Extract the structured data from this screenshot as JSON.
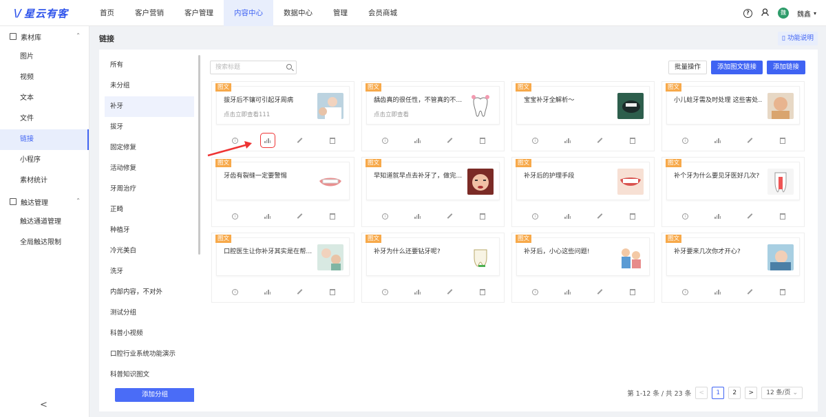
{
  "app": {
    "logo_mark": "\\/",
    "logo_text": "星云有客"
  },
  "nav": [
    {
      "label": "首页"
    },
    {
      "label": "客户营销"
    },
    {
      "label": "客户管理"
    },
    {
      "label": "内容中心",
      "active": true
    },
    {
      "label": "数据中心"
    },
    {
      "label": "管理"
    },
    {
      "label": "会员商城"
    }
  ],
  "user": {
    "avatar_text": "魏",
    "name": "魏鑫"
  },
  "sidebar": {
    "groups": [
      {
        "label": "素材库",
        "items": [
          "图片",
          "视频",
          "文本",
          "文件",
          "链接",
          "小程序",
          "素材统计"
        ]
      },
      {
        "label": "触达管理",
        "items": [
          "触达通道管理",
          "全局触达限制"
        ]
      }
    ],
    "active_item": "链接",
    "collapse_icon": "<"
  },
  "page": {
    "title": "链接",
    "help_label": "功能说明"
  },
  "categories": {
    "items": [
      "所有",
      "未分组",
      "补牙",
      "拔牙",
      "固定修复",
      "活动修复",
      "牙周治疗",
      "正畸",
      "种植牙",
      "冷光美白",
      "洗牙",
      "内部内容，不对外",
      "测试分组",
      "科普小视频",
      "口腔行业系统功能演示",
      "科普知识图文"
    ],
    "active": "补牙",
    "add_label": "添加分组"
  },
  "toolbar": {
    "search_placeholder": "搜索标题",
    "batch_label": "批量操作",
    "add_article_label": "添加图文链接",
    "add_link_label": "添加链接"
  },
  "cards": [
    {
      "tag": "图文",
      "title": "拔牙后不镶可引起牙周病",
      "subtitle": "点击立即查看111",
      "thumb": "dentist-photo",
      "highlight_stats": true
    },
    {
      "tag": "图文",
      "title": "龋齿真的很任性，不管真的不...",
      "subtitle": "点击立即查看",
      "thumb": "tooth-cartoon"
    },
    {
      "tag": "图文",
      "title": "宝宝补牙全解析～",
      "subtitle": "",
      "thumb": "mouth-closeup"
    },
    {
      "tag": "图文",
      "title": "小儿蛀牙需及时处理 这些害处...",
      "subtitle": "",
      "thumb": "child-photo"
    },
    {
      "tag": "图文",
      "title": "牙齿有裂缝一定要警惕",
      "subtitle": "",
      "thumb": "teeth-illustration"
    },
    {
      "tag": "图文",
      "title": "早知道就早点去补牙了，做完...",
      "subtitle": "",
      "thumb": "crying-face"
    },
    {
      "tag": "图文",
      "title": "补牙后的护理手段",
      "subtitle": "",
      "thumb": "smile-teeth"
    },
    {
      "tag": "图文",
      "title": "补个牙为什么要见牙医好几次?",
      "subtitle": "",
      "thumb": "tooth-diagram"
    },
    {
      "tag": "图文",
      "title": "口腔医生让你补牙其实是在帮...",
      "subtitle": "",
      "thumb": "dentist-patient"
    },
    {
      "tag": "图文",
      "title": "补牙为什么还要钻牙呢?",
      "subtitle": "",
      "thumb": "drill-diagram"
    },
    {
      "tag": "图文",
      "title": "补牙后，小心这些问题!",
      "subtitle": "",
      "thumb": "cartoon-people"
    },
    {
      "tag": "图文",
      "title": "补牙要来几次你才开心?",
      "subtitle": "",
      "thumb": "dental-exam"
    }
  ],
  "pagination": {
    "summary": "第 1-12 条 / 共 23 条",
    "prev": "<",
    "pages": [
      "1",
      "2"
    ],
    "current": "1",
    "next": ">",
    "per_page": "12 条/页"
  },
  "colors": {
    "primary": "#3f63f3",
    "tag": "#f7a94a",
    "highlight": "#e33333"
  }
}
